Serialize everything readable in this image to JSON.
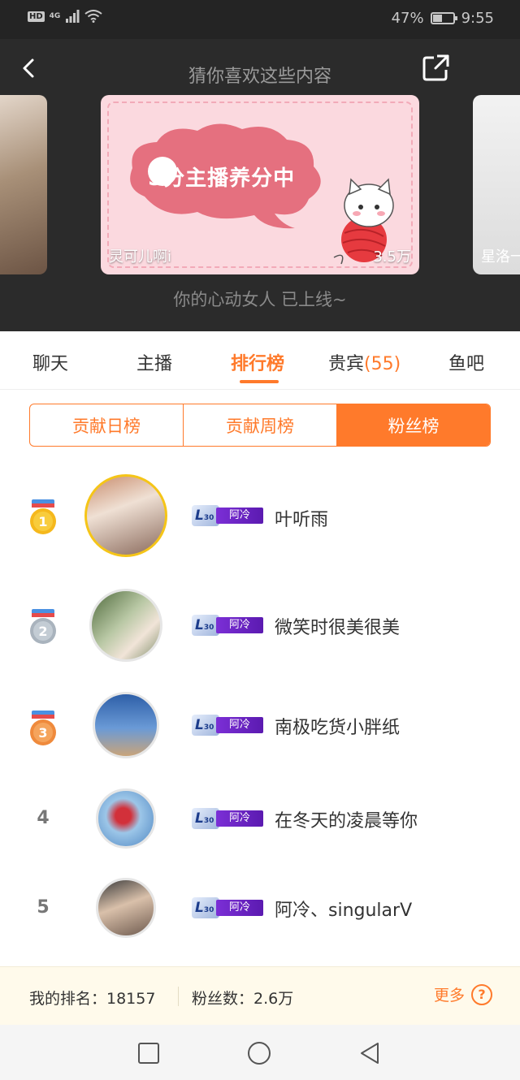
{
  "status_bar": {
    "hd": "HD",
    "network": "4G",
    "battery": "47%",
    "battery_level": 0.47,
    "time": "9:55"
  },
  "header": {
    "title": "猜你喜欢这些内容",
    "subtitle": "你的心动女人 已上线~",
    "cards": {
      "main_caption_left": "灵可儿啊i",
      "main_caption_right": "3.5万",
      "main_banner_text": "5分主播养分中",
      "right_caption": "星洛一"
    }
  },
  "tabs": [
    {
      "label": "聊天"
    },
    {
      "label": "主播"
    },
    {
      "label": "排行榜"
    },
    {
      "label": "贵宾",
      "count": "(55)"
    },
    {
      "label": "鱼吧"
    }
  ],
  "segment": [
    "贡献日榜",
    "贡献周榜",
    "粉丝榜"
  ],
  "ranking": [
    {
      "rank": "1",
      "level": "30",
      "level_prefix": "L",
      "badge": "阿冷",
      "name": "叶听雨"
    },
    {
      "rank": "2",
      "level": "30",
      "level_prefix": "L",
      "badge": "阿冷",
      "name": "微笑时很美很美"
    },
    {
      "rank": "3",
      "level": "30",
      "level_prefix": "L",
      "badge": "阿冷",
      "name": "南极吃货小胖纸"
    },
    {
      "rank": "4",
      "level": "30",
      "level_prefix": "L",
      "badge": "阿冷",
      "name": "在冬天的凌晨等你"
    },
    {
      "rank": "5",
      "level": "30",
      "level_prefix": "L",
      "badge": "阿冷",
      "name": "阿冷、singularV"
    }
  ],
  "footer": {
    "my_rank": "我的排名：18157",
    "fans": "粉丝数：2.6万",
    "more": "更多",
    "help": "?"
  },
  "colors": {
    "accent": "#ff7a2b",
    "header_bg": "#2b2b2b",
    "level_purple": "#7b2fd6"
  },
  "icons": [
    "back-icon",
    "share-icon",
    "medal-gold-icon",
    "medal-silver-icon",
    "medal-bronze-icon",
    "help-icon",
    "nav-recents-icon",
    "nav-home-icon",
    "nav-back-icon"
  ]
}
